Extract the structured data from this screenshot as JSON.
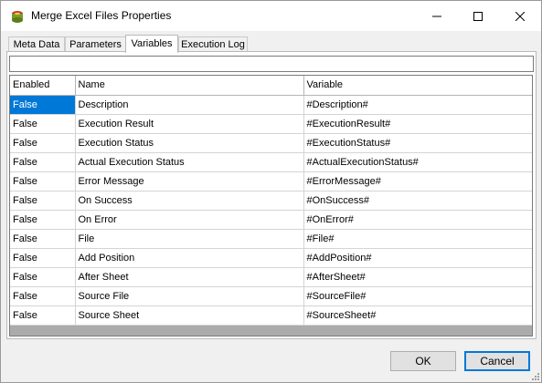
{
  "window": {
    "title": "Merge Excel Files Properties",
    "icon": "merge-excel-app-icon",
    "controls": {
      "minimize_icon": "minimize-icon",
      "maximize_icon": "maximize-icon",
      "close_icon": "close-icon"
    }
  },
  "tabs": [
    {
      "label": "Meta Data",
      "active": false
    },
    {
      "label": "Parameters",
      "active": false
    },
    {
      "label": "Variables",
      "active": true
    },
    {
      "label": "Execution Log",
      "active": false
    }
  ],
  "filter": {
    "value": "",
    "placeholder": ""
  },
  "grid": {
    "columns": [
      "Enabled",
      "Name",
      "Variable"
    ],
    "rows": [
      {
        "enabled": "False",
        "name": "Description",
        "variable": "#Description#"
      },
      {
        "enabled": "False",
        "name": "Execution Result",
        "variable": "#ExecutionResult#"
      },
      {
        "enabled": "False",
        "name": "Execution Status",
        "variable": "#ExecutionStatus#"
      },
      {
        "enabled": "False",
        "name": "Actual Execution Status",
        "variable": "#ActualExecutionStatus#"
      },
      {
        "enabled": "False",
        "name": "Error Message",
        "variable": "#ErrorMessage#"
      },
      {
        "enabled": "False",
        "name": "On Success",
        "variable": "#OnSuccess#"
      },
      {
        "enabled": "False",
        "name": "On Error",
        "variable": "#OnError#"
      },
      {
        "enabled": "False",
        "name": "File",
        "variable": "#File#"
      },
      {
        "enabled": "False",
        "name": "Add Position",
        "variable": "#AddPosition#"
      },
      {
        "enabled": "False",
        "name": "After Sheet",
        "variable": "#AfterSheet#"
      },
      {
        "enabled": "False",
        "name": "Source File",
        "variable": "#SourceFile#"
      },
      {
        "enabled": "False",
        "name": "Source Sheet",
        "variable": "#SourceSheet#"
      }
    ],
    "selected_cell": {
      "row": 0,
      "column": "enabled"
    }
  },
  "buttons": {
    "ok": "OK",
    "cancel": "Cancel"
  },
  "colors": {
    "selection": "#0078d7",
    "default_button_border": "#0078d7",
    "grid_background": "#ababab"
  }
}
